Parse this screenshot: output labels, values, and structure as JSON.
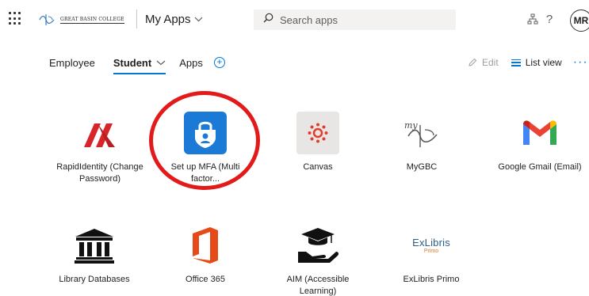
{
  "header": {
    "logo_text": "GREAT BASIN COLLEGE",
    "app_title": "My Apps",
    "search_placeholder": "Search apps",
    "org_chart_icon": "org-chart-icon",
    "help_label": "?",
    "avatar_initials": "MR"
  },
  "tabs": [
    {
      "label": "Employee",
      "active": false
    },
    {
      "label": "Student",
      "active": true
    },
    {
      "label": "Apps",
      "active": false
    }
  ],
  "toolbar": {
    "edit_label": "Edit",
    "list_view_label": "List view",
    "more_label": "···"
  },
  "apps": [
    {
      "label": "RapidIdentity (Change Password)",
      "icon": "rapididentity-logo"
    },
    {
      "label": "Set up MFA (Multi factor...",
      "icon": "mfa-lock-icon"
    },
    {
      "label": "Canvas",
      "icon": "canvas-logo"
    },
    {
      "label": "MyGBC",
      "icon": "mygbc-logo"
    },
    {
      "label": "Google Gmail (Email)",
      "icon": "gmail-logo"
    },
    {
      "label": "Library Databases",
      "icon": "library-icon"
    },
    {
      "label": "Office 365",
      "icon": "office365-logo"
    },
    {
      "label": "AIM (Accessible Learning)",
      "icon": "aim-icon"
    },
    {
      "label": "ExLibris Primo",
      "icon": "exlibris-logo"
    }
  ],
  "exlibris": {
    "brand": "ExLibris",
    "sub": "Primo"
  },
  "mygbc_text": "my",
  "colors": {
    "accent": "#0078d4",
    "highlight_circle": "#e31a1a",
    "mfa_blue": "#1a7ad6",
    "canvas_red": "#e13d2d",
    "office_orange": "#e64a19",
    "rapid_red": "#d7262b"
  }
}
